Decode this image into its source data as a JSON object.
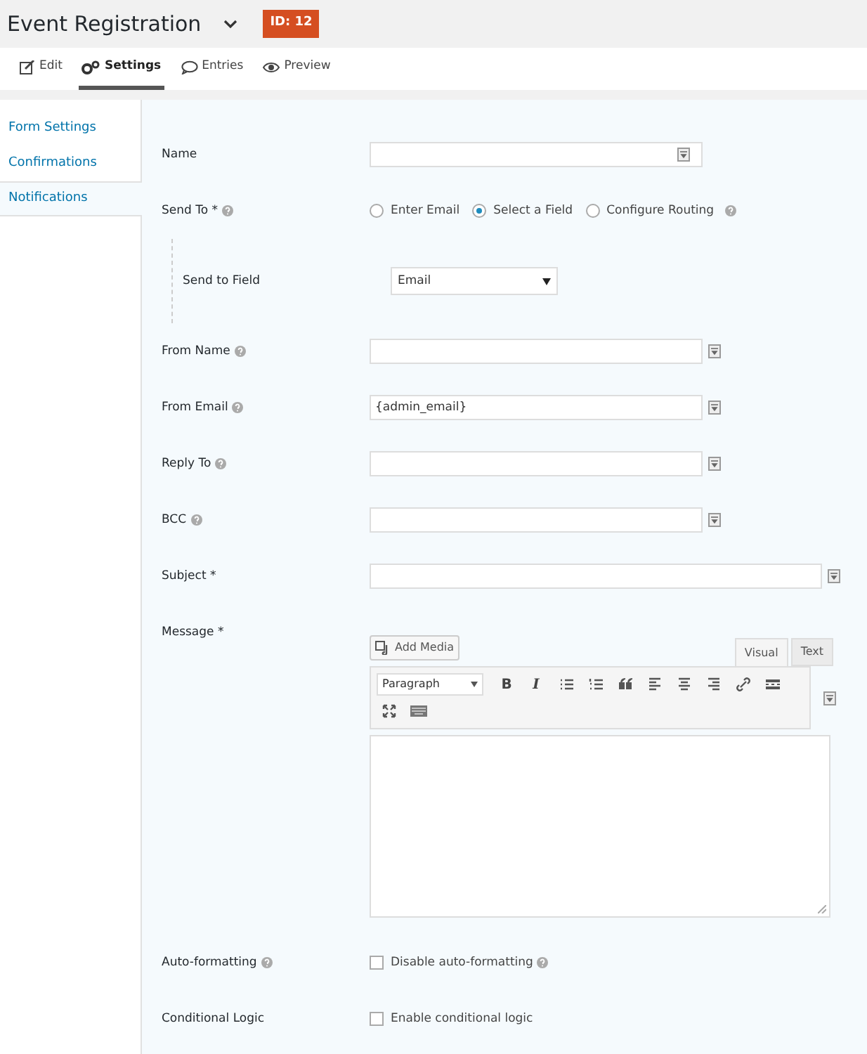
{
  "header": {
    "title": "Event Registration",
    "badge": "ID: 12"
  },
  "tabs": [
    {
      "kind": "edit",
      "label": "Edit",
      "selected": false
    },
    {
      "kind": "settings",
      "label": "Settings",
      "selected": true
    },
    {
      "kind": "entries",
      "label": "Entries",
      "selected": false
    },
    {
      "kind": "preview",
      "label": "Preview",
      "selected": false
    }
  ],
  "sidebar": {
    "items": [
      {
        "label": "Form Settings",
        "selected": false
      },
      {
        "label": "Confirmations",
        "selected": false
      },
      {
        "label": "Notifications",
        "selected": true
      }
    ]
  },
  "fields": [
    {
      "kind": "tagged-text",
      "label": "Name",
      "help": false
    },
    {
      "kind": "radio",
      "label": "Send To *",
      "help": true,
      "options": [
        {
          "label": "Enter Email",
          "selected": false,
          "help": false
        },
        {
          "label": "Select a Field",
          "selected": true,
          "help": false
        },
        {
          "label": "Configure Routing",
          "selected": false,
          "help": true
        }
      ]
    },
    {
      "kind": "select",
      "label": "Send to Field",
      "value": "Email"
    },
    {
      "kind": "text",
      "label": "From Name",
      "help": true
    },
    {
      "kind": "text",
      "label": "From Email",
      "help": true,
      "value": "{admin_email}"
    },
    {
      "kind": "text",
      "label": "Reply To",
      "help": true
    },
    {
      "kind": "text",
      "label": "BCC",
      "help": true
    },
    {
      "kind": "wide-text",
      "label": "Subject *",
      "help": false
    },
    {
      "kind": "editor",
      "label": "Message *",
      "media_button": "Add Media",
      "editor_tabs": [
        {
          "label": "Visual",
          "selected": true
        },
        {
          "label": "Text",
          "selected": false
        }
      ],
      "format": "Paragraph",
      "toolbar": [
        {
          "kind": "bold",
          "label": "B"
        },
        {
          "kind": "italic",
          "label": "I"
        },
        {
          "kind": "bullets"
        },
        {
          "kind": "numbers"
        },
        {
          "kind": "quote"
        },
        {
          "kind": "align-left"
        },
        {
          "kind": "align-center"
        },
        {
          "kind": "align-right"
        },
        {
          "kind": "link"
        },
        {
          "kind": "more"
        },
        {
          "kind": "fullscreen"
        },
        {
          "kind": "kitchen-sink"
        }
      ]
    },
    {
      "kind": "checkbox",
      "label": "Auto-formatting",
      "help": true,
      "option": "Disable auto-formatting",
      "option_help": true,
      "checked": false
    },
    {
      "kind": "checkbox",
      "label": "Conditional Logic",
      "help": false,
      "option": "Enable conditional logic",
      "option_help": false,
      "checked": false
    }
  ]
}
